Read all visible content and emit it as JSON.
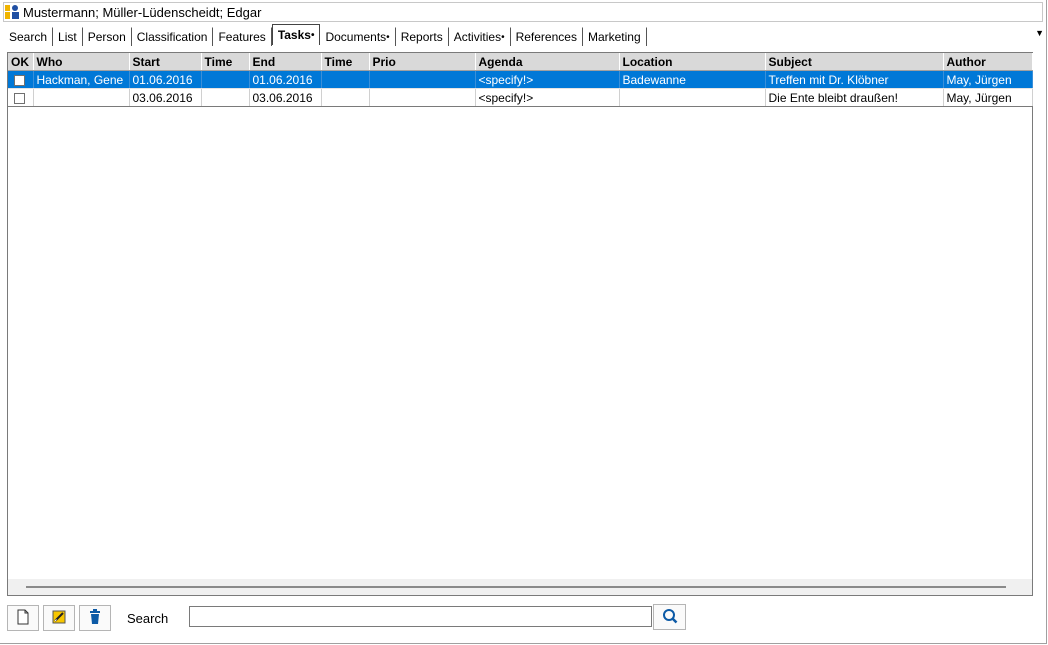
{
  "window": {
    "title": "Mustermann; Müller-Lüdenscheidt; Edgar",
    "title_icon": "person-card-icon"
  },
  "tabs": [
    {
      "label": "Search",
      "dot": ""
    },
    {
      "label": "List",
      "dot": ""
    },
    {
      "label": "Person",
      "dot": ""
    },
    {
      "label": "Classification",
      "dot": ""
    },
    {
      "label": "Features",
      "dot": ""
    },
    {
      "label": "Tasks",
      "dot": "•",
      "active": true
    },
    {
      "label": "Documents",
      "dot": "•"
    },
    {
      "label": "Reports",
      "dot": ""
    },
    {
      "label": "Activities",
      "dot": "•"
    },
    {
      "label": "References",
      "dot": ""
    },
    {
      "label": "Marketing",
      "dot": ""
    }
  ],
  "grid": {
    "columns": [
      "OK",
      "Who",
      "Start",
      "Time",
      "End",
      "Time",
      "Prio",
      "Agenda",
      "Location",
      "Subject",
      "Author"
    ],
    "rows": [
      {
        "ok": false,
        "who": "Hackman, Gene",
        "start": "01.06.2016",
        "start_time": "",
        "end": "01.06.2016",
        "end_time": "",
        "prio": "",
        "agenda": "<specify!>",
        "location": "Badewanne",
        "subject": "Treffen mit Dr. Klöbner",
        "author": "May, Jürgen",
        "selected": true
      },
      {
        "ok": false,
        "who": "",
        "start": "03.06.2016",
        "start_time": "",
        "end": "03.06.2016",
        "end_time": "",
        "prio": "",
        "agenda": "<specify!>",
        "location": "",
        "subject": "Die Ente bleibt draußen!",
        "author": "May, Jürgen",
        "selected": false
      }
    ]
  },
  "toolbar": {
    "new_icon": "new-document-icon",
    "edit_icon": "edit-note-icon",
    "delete_icon": "trash-icon",
    "search_label": "Search",
    "search_value": "",
    "search_icon": "magnifier-icon"
  },
  "colors": {
    "selection": "#0078d7",
    "header_bg": "#d9d9d9",
    "accent": "#0c5aa6"
  }
}
